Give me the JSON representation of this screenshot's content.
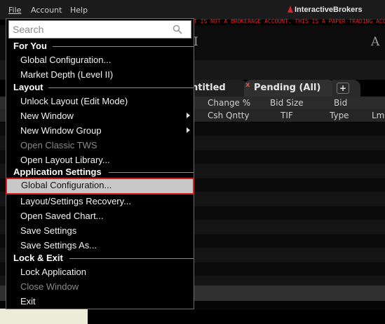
{
  "menubar": {
    "items": [
      "File",
      "Account",
      "Help"
    ],
    "brand": "InteractiveBrokers",
    "paper_warning": "T IS NOT A BROKERAGE ACCOUNT. THIS IS A PAPER TRADING ACCOUNT"
  },
  "toolbar": {
    "left_glyph": "I",
    "right_glyph": "A"
  },
  "tabs": [
    {
      "label": "ntitled"
    },
    {
      "label": "Pending (All)",
      "close": "x"
    },
    {
      "label": "+"
    }
  ],
  "columns": {
    "row1": [
      "Change %",
      "Bid Size",
      "Bid"
    ],
    "row2": [
      "Csh Qntty",
      "TIF",
      "Type",
      "Lm"
    ]
  },
  "menu": {
    "search_placeholder": "Search",
    "sections": [
      {
        "title": "For You",
        "items": [
          {
            "label": "Global Configuration...",
            "enabled": true
          },
          {
            "label": "Market Depth (Level II)",
            "enabled": true
          }
        ]
      },
      {
        "title": "Layout",
        "items": [
          {
            "label": "Unlock Layout (Edit Mode)",
            "enabled": true
          },
          {
            "label": "New Window",
            "enabled": true,
            "submenu": true
          },
          {
            "label": "New Window Group",
            "enabled": true,
            "submenu": true
          },
          {
            "label": "Open Classic TWS",
            "enabled": false
          },
          {
            "label": "Open Layout Library...",
            "enabled": true
          }
        ]
      },
      {
        "title": "Application Settings",
        "items": [
          {
            "label": "Global Configuration...",
            "enabled": true,
            "highlighted": true
          },
          {
            "label": "Layout/Settings Recovery...",
            "enabled": true
          },
          {
            "label": "Open Saved Chart...",
            "enabled": true
          },
          {
            "label": "Save Settings",
            "enabled": true
          },
          {
            "label": "Save Settings As...",
            "enabled": true
          }
        ]
      },
      {
        "title": "Lock & Exit",
        "items": [
          {
            "label": "Lock Application",
            "enabled": true
          },
          {
            "label": "Close Window",
            "enabled": false
          },
          {
            "label": "Exit",
            "enabled": true
          }
        ]
      }
    ]
  },
  "colors": {
    "highlight_border": "#d21f1f",
    "highlight_bg": "#c8c8c8",
    "disabled_text": "#8a8a8a"
  }
}
